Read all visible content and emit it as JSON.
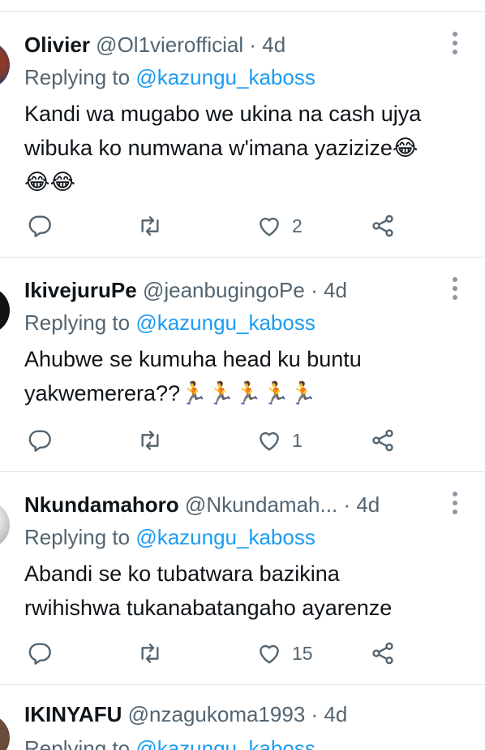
{
  "tweets": [
    {
      "name": "Olivier",
      "handle": "@Ol1vierofficial",
      "time": "4d",
      "replying_prefix": "Replying to",
      "replying_to": "@kazungu_kaboss",
      "line1": "Kandi wa mugabo we ukina na cash ujya",
      "line2": "wibuka ko numwana w'imana yazizize😂",
      "line3": "😂😂",
      "likes": "2"
    },
    {
      "name": "IkivejuruPe",
      "handle": "@jeanbugingoPe",
      "time": "4d",
      "replying_prefix": "Replying to",
      "replying_to": "@kazungu_kaboss",
      "line1": "Ahubwe se kumuha head ku buntu",
      "line2": "yakwemerera??🏃🏃🏃🏃🏃",
      "likes": "1"
    },
    {
      "name": "Nkundamahoro",
      "handle": "@Nkundamah...",
      "time": "4d",
      "replying_prefix": "Replying to",
      "replying_to": "@kazungu_kaboss",
      "line1": "Abandi se ko tubatwara bazikina",
      "line2": "rwihishwa tukanabatangaho ayarenze",
      "likes": "15"
    },
    {
      "name": "IKINYAFU",
      "handle": "@nzagukoma1993",
      "time": "4d",
      "replying_prefix": "Replying to",
      "replying_to": "@kazungu_kaboss"
    }
  ],
  "sep": "·",
  "icons": {
    "reply": "reply-icon",
    "retweet": "retweet-icon",
    "like": "heart-icon",
    "share": "share-icon",
    "more": "more-options-icon"
  },
  "colors": {
    "text": "#0f1419",
    "secondary": "#536471",
    "link": "#1d9bf0",
    "divider": "#e1e8ed"
  }
}
